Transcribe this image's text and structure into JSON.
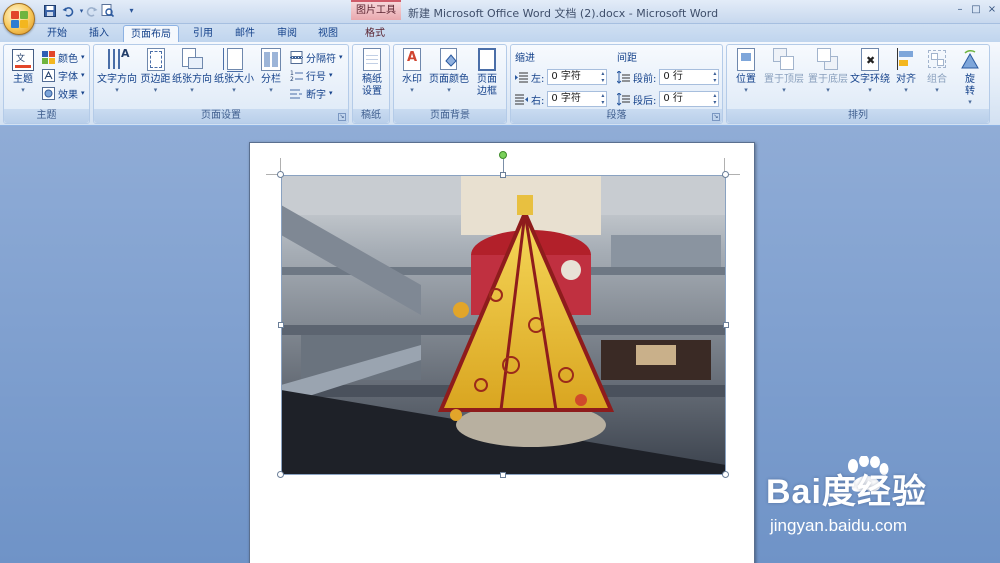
{
  "window": {
    "title": "新建 Microsoft Office Word 文档 (2).docx - Microsoft Word",
    "context_tools": "图片工具",
    "controls": [
      "–",
      "□",
      "×"
    ]
  },
  "quick_access": {
    "icons": [
      "save-icon",
      "undo-icon",
      "redo-icon",
      "print-preview-icon",
      "customize-icon"
    ]
  },
  "tabs": [
    {
      "label": "开始"
    },
    {
      "label": "插入"
    },
    {
      "label": "页面布局",
      "active": true
    },
    {
      "label": "引用"
    },
    {
      "label": "邮件"
    },
    {
      "label": "审阅"
    },
    {
      "label": "视图"
    },
    {
      "label": "格式",
      "context": true
    }
  ],
  "ribbon": {
    "theme_group": {
      "label": "主题",
      "big_button": "主题",
      "small": [
        "颜色",
        "字体",
        "效果"
      ]
    },
    "page_setup": {
      "label": "页面设置",
      "buttons": [
        "文字方向",
        "页边距",
        "纸张方向",
        "纸张大小",
        "分栏"
      ],
      "small": [
        "分隔符",
        "行号",
        "断字"
      ]
    },
    "paper_group": {
      "label": "稿纸",
      "button_line1": "稿纸",
      "button_line2": "设置"
    },
    "page_background": {
      "label": "页面背景",
      "buttons": [
        {
          "l1": "水印",
          "l2": ""
        },
        {
          "l1": "页面颜色",
          "l2": ""
        },
        {
          "l1": "页面",
          "l2": "边框"
        }
      ]
    },
    "paragraph": {
      "label": "段落",
      "indent_title": "缩进",
      "spacing_title": "间距",
      "left_label": "左:",
      "left_value": "0 字符",
      "right_label": "右:",
      "right_value": "0 字符",
      "before_label": "段前:",
      "before_value": "0 行",
      "after_label": "段后:",
      "after_value": "0 行"
    },
    "arrange": {
      "label": "排列",
      "buttons": [
        {
          "l1": "位置",
          "l2": "",
          "disabled": false
        },
        {
          "l1": "置于顶层",
          "l2": "",
          "disabled": true
        },
        {
          "l1": "置于底层",
          "l2": "",
          "disabled": true
        },
        {
          "l1": "文字环绕",
          "l2": "",
          "disabled": false
        },
        {
          "l1": "对齐",
          "l2": "",
          "disabled": false
        },
        {
          "l1": "组合",
          "l2": "",
          "disabled": true
        },
        {
          "l1": "旋",
          "l2": "转",
          "disabled": false
        }
      ]
    }
  },
  "watermark": {
    "brand": "Bai度经验",
    "url": "jingyan.baidu.com"
  }
}
